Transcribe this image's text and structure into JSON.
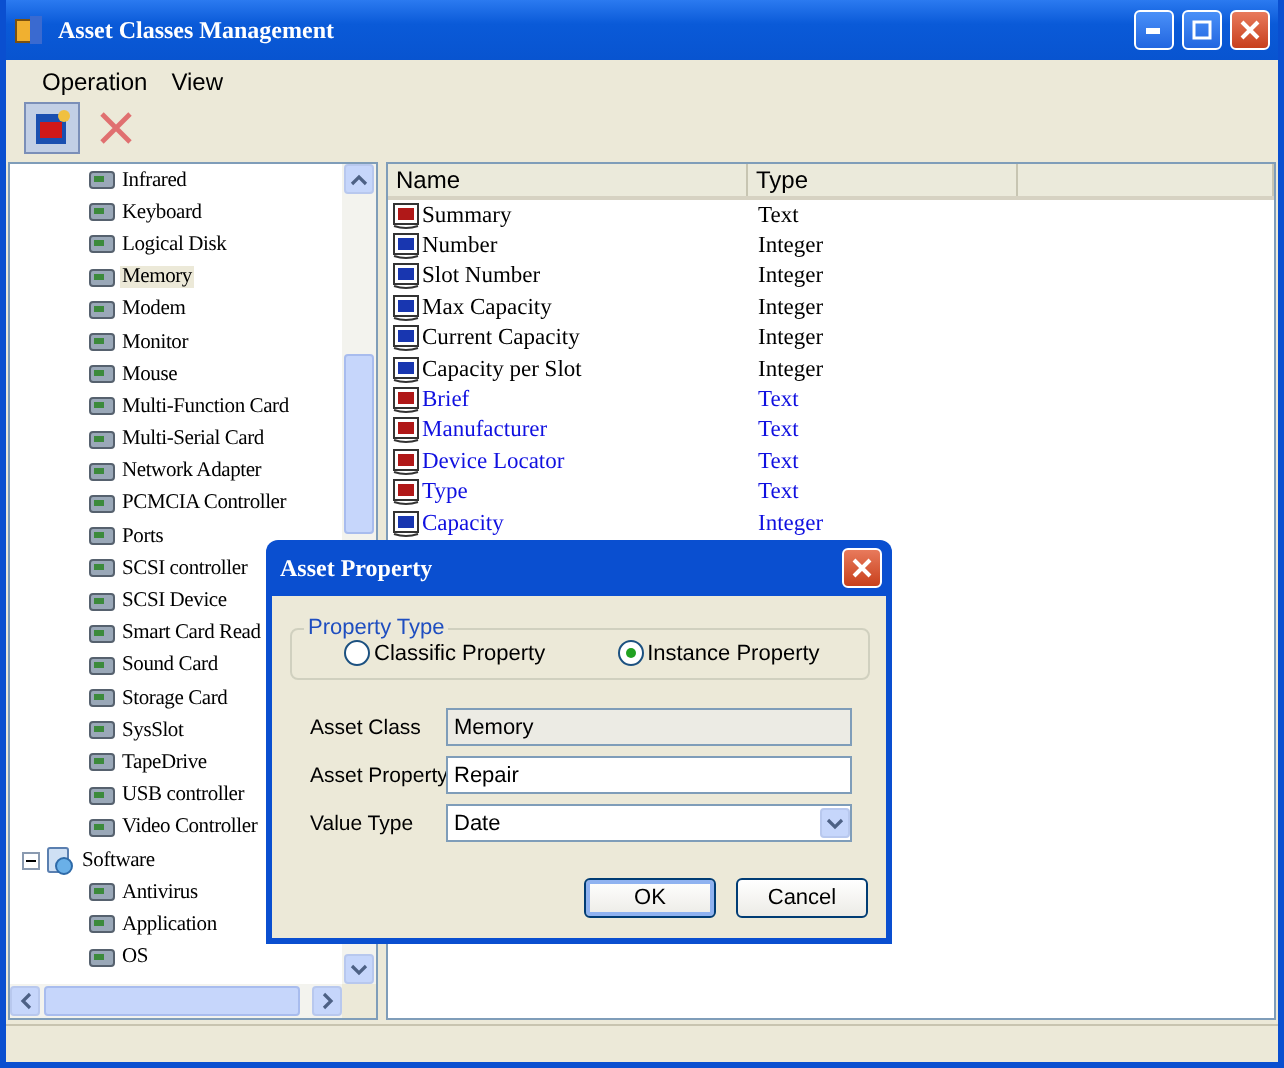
{
  "window": {
    "title": "Asset Classes Management"
  },
  "menu": [
    {
      "label": "Operation"
    },
    {
      "label": "View"
    }
  ],
  "toolbar": [
    {
      "kind": "add",
      "pressed": true
    },
    {
      "kind": "delete",
      "pressed": false
    }
  ],
  "tree": {
    "items": [
      {
        "children": [
          {
            "label": "Infrared",
            "selected": false
          },
          {
            "label": "Keyboard",
            "selected": false
          },
          {
            "label": "Logical Disk",
            "selected": false
          },
          {
            "label": "Memory",
            "selected": true
          },
          {
            "label": "Modem",
            "selected": false
          },
          {
            "label": "Monitor",
            "selected": false
          },
          {
            "label": "Mouse",
            "selected": false
          },
          {
            "label": "Multi-Function Card",
            "selected": false
          },
          {
            "label": "Multi-Serial Card",
            "selected": false
          },
          {
            "label": "Network Adapter",
            "selected": false
          },
          {
            "label": "PCMCIA Controller",
            "selected": false
          },
          {
            "label": "Ports",
            "selected": false
          },
          {
            "label": "SCSI controller",
            "selected": false
          },
          {
            "label": "SCSI Device",
            "selected": false
          },
          {
            "label": "Smart Card Read",
            "selected": false
          },
          {
            "label": "Sound Card",
            "selected": false
          },
          {
            "label": "Storage Card",
            "selected": false
          },
          {
            "label": "SysSlot",
            "selected": false
          },
          {
            "label": "TapeDrive",
            "selected": false
          },
          {
            "label": "USB controller",
            "selected": false
          },
          {
            "label": "Video Controller",
            "selected": false
          }
        ]
      },
      {
        "label": "Software",
        "selected": false,
        "expanded": true,
        "children": [
          {
            "label": "Antivirus",
            "selected": false
          },
          {
            "label": "Application",
            "selected": false
          },
          {
            "label": "OS",
            "selected": false
          }
        ]
      }
    ]
  },
  "table": {
    "columns": [
      "Name",
      "Type"
    ],
    "rows": [
      {
        "name": "Summary",
        "type": "Text",
        "kind": "text",
        "instance": false
      },
      {
        "name": "Number",
        "type": "Integer",
        "kind": "integer",
        "instance": false
      },
      {
        "name": "Slot Number",
        "type": "Integer",
        "kind": "integer",
        "instance": false
      },
      {
        "name": "Max Capacity",
        "type": "Integer",
        "kind": "integer",
        "instance": false
      },
      {
        "name": "Current Capacity",
        "type": "Integer",
        "kind": "integer",
        "instance": false
      },
      {
        "name": "Capacity per Slot",
        "type": "Integer",
        "kind": "integer",
        "instance": false
      },
      {
        "name": "Brief",
        "type": "Text",
        "kind": "text",
        "instance": true
      },
      {
        "name": "Manufacturer",
        "type": "Text",
        "kind": "text",
        "instance": true
      },
      {
        "name": "Device Locator",
        "type": "Text",
        "kind": "text",
        "instance": true
      },
      {
        "name": "Type",
        "type": "Text",
        "kind": "text",
        "instance": true
      },
      {
        "name": "Capacity",
        "type": "Integer",
        "kind": "integer",
        "instance": true
      }
    ]
  },
  "dialog": {
    "title": "Asset Property",
    "group": "Property Type",
    "options": [
      {
        "label": "Classific Property",
        "selected": false
      },
      {
        "label": "Instance Property",
        "selected": true
      }
    ],
    "fields": [
      {
        "label": "Asset Class",
        "value": "Memory",
        "kind": "readonly"
      },
      {
        "label": "Asset Property",
        "value": "Repair",
        "kind": "input"
      },
      {
        "label": "Value Type",
        "value": "Date",
        "kind": "select"
      }
    ],
    "buttons": [
      {
        "label": "OK",
        "default": true
      },
      {
        "label": "Cancel",
        "default": false
      }
    ]
  }
}
